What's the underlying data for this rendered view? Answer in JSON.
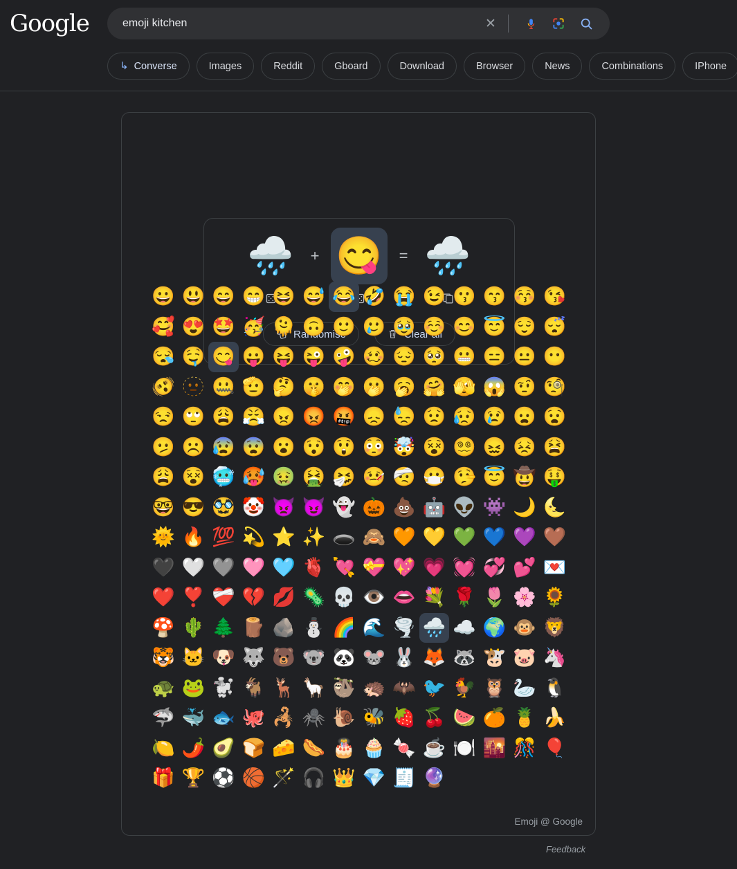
{
  "header": {
    "logo": "Google",
    "search": {
      "value": "emoji kitchen",
      "placeholder": "Search",
      "clear_icon": "close-x-icon",
      "mic_icon": "microphone-icon",
      "lens_icon": "google-lens-icon",
      "search_icon": "search-magnifier-icon"
    },
    "chips": [
      {
        "label": "Converse",
        "icon": "reply-arrow-icon",
        "has_icon": true
      },
      {
        "label": "Images",
        "has_icon": false
      },
      {
        "label": "Reddit",
        "has_icon": false
      },
      {
        "label": "Gboard",
        "has_icon": false
      },
      {
        "label": "Download",
        "has_icon": false
      },
      {
        "label": "Browser",
        "has_icon": false
      },
      {
        "label": "News",
        "has_icon": false
      },
      {
        "label": "Combinations",
        "has_icon": false
      },
      {
        "label": "IPhone",
        "has_icon": false
      }
    ]
  },
  "widget": {
    "left_emoji": "🌧️",
    "left_emoji_name": "cloud-with-rain",
    "operator_plus": "+",
    "right_emoji": "😋",
    "right_emoji_name": "face-savoring-food",
    "right_selected": true,
    "operator_equals": "=",
    "result_emoji": "🌧️",
    "result_emoji_name": "cloud-with-rain-savoring-mashup",
    "dice_left_icon": "dice-icon",
    "dice_right_icon": "dice-icon",
    "copy_icon": "copy-icon",
    "randomise_label": "Randomise",
    "randomise_icon": "shuffle-dice-icon",
    "clear_label": "Clear all",
    "clear_icon": "trash-icon"
  },
  "colors": {
    "page_bg": "#202124",
    "search_bg": "#303134",
    "border": "#3c4043",
    "selected_bg": "#37414f",
    "accent_blue": "#8ab4f8",
    "text": "#e8eaed",
    "muted_text": "#9aa0a6"
  },
  "footer": {
    "attribution": "Emoji @ Google",
    "feedback": "Feedback"
  },
  "grid": {
    "selected": [
      "😋",
      "🌧️"
    ],
    "rows": [
      [
        "😀",
        "😃",
        "😄",
        "😁",
        "😆",
        "😅",
        "😂",
        "🤣",
        "😭",
        "😉",
        "😗",
        "😙",
        "😚",
        "😘"
      ],
      [
        "🥰",
        "😍",
        "🤩",
        "🥳",
        "🫠",
        "🙃",
        "🙂",
        "🥲",
        "🥹",
        "☺️",
        "😊",
        "😇",
        "😌",
        "😴"
      ],
      [
        "😪",
        "🤤",
        "😋",
        "😛",
        "😝",
        "😜",
        "🤪",
        "🥴",
        "😔",
        "🥺",
        "😬",
        "😑",
        "😐",
        "😶"
      ],
      [
        "🫨",
        "🫥",
        "🤐",
        "🫡",
        "🤔",
        "🤫",
        "🤭",
        "🫢",
        "🥱",
        "🤗",
        "🫣",
        "😱",
        "🤨",
        "🧐"
      ],
      [
        "😒",
        "🙄",
        "😩",
        "😤",
        "😠",
        "😡",
        "🤬",
        "😞",
        "😓",
        "😟",
        "😥",
        "😢",
        "😦",
        "😧"
      ],
      [
        "🫤",
        "☹️",
        "😰",
        "😨",
        "😮",
        "😯",
        "😲",
        "😳",
        "🤯",
        "😵",
        "😵‍💫",
        "😖",
        "😣",
        "😫"
      ],
      [
        "😩",
        "😵",
        "🥶",
        "🥵",
        "🤢",
        "🤮",
        "🤧",
        "🤒",
        "🤕",
        "😷",
        "🤥",
        "😇",
        "🤠",
        "🤑"
      ],
      [
        "🤓",
        "😎",
        "🥸",
        "🤡",
        "👿",
        "😈",
        "👻",
        "🎃",
        "💩",
        "🤖",
        "👽",
        "👾",
        "🌙",
        "🌜"
      ],
      [
        "🌞",
        "🔥",
        "💯",
        "💫",
        "⭐",
        "✨",
        "🕳️",
        "🙈",
        "🧡",
        "💛",
        "💚",
        "💙",
        "💜",
        "🤎"
      ],
      [
        "🖤",
        "🤍",
        "🩶",
        "🩷",
        "🩵",
        "🫀",
        "💘",
        "💝",
        "💖",
        "💗",
        "💓",
        "💞",
        "💕",
        "💌"
      ],
      [
        "❤️",
        "❣️",
        "❤️‍🩹",
        "💔",
        "💋",
        "🦠",
        "💀",
        "👁️",
        "👄",
        "💐",
        "🌹",
        "🌷",
        "🌸",
        "🌻"
      ],
      [
        "🍄",
        "🌵",
        "🌲",
        "🪵",
        "🪨",
        "⛄",
        "🌈",
        "🌊",
        "🌪️",
        "🌧️",
        "☁️",
        "🌍",
        "🐵",
        "🦁"
      ],
      [
        "🐯",
        "🐱",
        "🐶",
        "🐺",
        "🐻",
        "🐨",
        "🐼",
        "🐭",
        "🐰",
        "🦊",
        "🦝",
        "🐮",
        "🐷",
        "🦄"
      ],
      [
        "🐢",
        "🐸",
        "🐩",
        "🐐",
        "🦌",
        "🦙",
        "🦥",
        "🦔",
        "🦇",
        "🐦",
        "🐓",
        "🦉",
        "🦢",
        "🐧"
      ],
      [
        "🦈",
        "🐳",
        "🐟",
        "🐙",
        "🦂",
        "🕷️",
        "🐌",
        "🐝",
        "🍓",
        "🍒",
        "🍉",
        "🍊",
        "🍍",
        "🍌"
      ],
      [
        "🍋",
        "🌶️",
        "🥑",
        "🍞",
        "🧀",
        "🌭",
        "🎂",
        "🧁",
        "🍬",
        "☕",
        "🍽️",
        "🌇",
        "🎊",
        "🎈"
      ],
      [
        "🎁",
        "🏆",
        "⚽",
        "🏀",
        "🪄",
        "🎧",
        "👑",
        "💎",
        "🧾",
        "🔮"
      ]
    ]
  }
}
